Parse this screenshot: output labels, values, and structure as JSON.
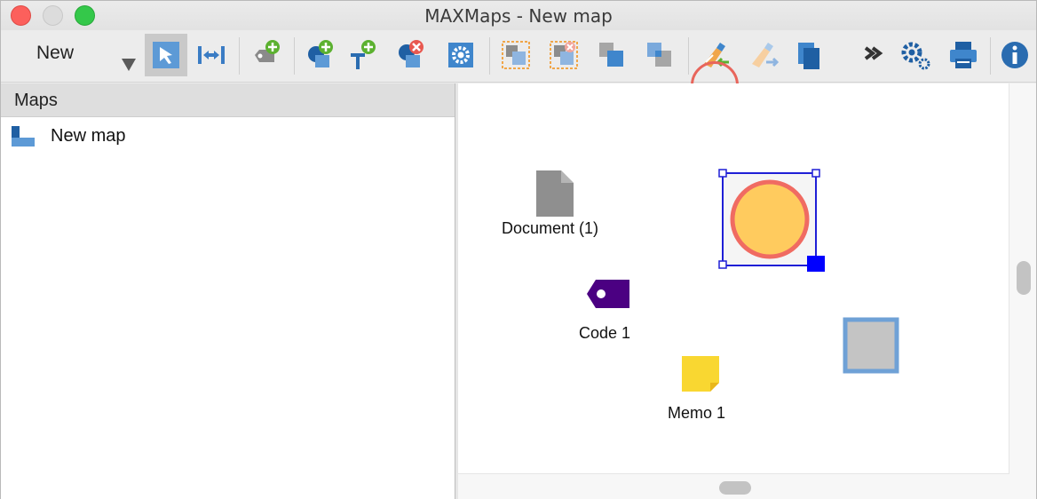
{
  "window": {
    "title": "MAXMaps - New map"
  },
  "toolbar": {
    "new_label": "New",
    "buttons": [
      {
        "name": "select-tool-icon"
      },
      {
        "name": "fit-width-icon"
      },
      {
        "name": "add-code-icon"
      },
      {
        "name": "add-object-icon"
      },
      {
        "name": "add-text-icon"
      },
      {
        "name": "delete-object-icon"
      },
      {
        "name": "settings-icon"
      },
      {
        "name": "group-icon"
      },
      {
        "name": "ungroup-icon"
      },
      {
        "name": "bring-front-icon"
      },
      {
        "name": "send-back-icon"
      },
      {
        "name": "import-format-icon"
      },
      {
        "name": "export-format-icon"
      },
      {
        "name": "copy-icon"
      },
      {
        "name": "more-icon"
      },
      {
        "name": "options-icon"
      },
      {
        "name": "print-icon"
      },
      {
        "name": "info-icon"
      }
    ]
  },
  "sidebar": {
    "header": "Maps",
    "items": [
      {
        "label": "New map"
      }
    ]
  },
  "canvas": {
    "objects": [
      {
        "label": "Document (1)",
        "type": "document"
      },
      {
        "label": "Code 1",
        "type": "code"
      },
      {
        "label": "Memo 1",
        "type": "memo"
      }
    ]
  },
  "colors": {
    "accent_blue": "#1a76d2",
    "code_purple": "#4b0082",
    "memo_yellow": "#f9d731",
    "circle_fill": "#ffcb5e",
    "circle_stroke": "#f06b62",
    "highlight_ring": "#e8655b"
  }
}
